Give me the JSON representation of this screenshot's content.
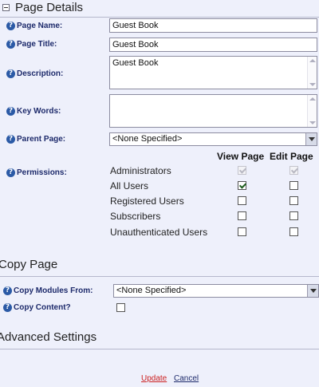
{
  "page_details": {
    "title": "Page Details",
    "fields": {
      "page_name": {
        "label": "Page Name:",
        "value": "Guest Book"
      },
      "page_title": {
        "label": "Page Title:",
        "value": "Guest Book"
      },
      "description": {
        "label": "Description:",
        "value": "Guest Book"
      },
      "key_words": {
        "label": "Key Words:",
        "value": ""
      },
      "parent_page": {
        "label": "Parent Page:",
        "value": "<None Specified>"
      },
      "permissions": {
        "label": "Permissions:"
      }
    },
    "permissions_table": {
      "columns": [
        "View Page",
        "Edit Page"
      ],
      "rows": [
        {
          "role": "Administrators",
          "view": true,
          "edit": true,
          "disabled": true
        },
        {
          "role": "All Users",
          "view": true,
          "edit": false,
          "disabled": false
        },
        {
          "role": "Registered Users",
          "view": false,
          "edit": false,
          "disabled": false
        },
        {
          "role": "Subscribers",
          "view": false,
          "edit": false,
          "disabled": false
        },
        {
          "role": "Unauthenticated Users",
          "view": false,
          "edit": false,
          "disabled": false
        }
      ]
    }
  },
  "copy_page": {
    "title": "Copy Page",
    "copy_modules_from": {
      "label": "Copy Modules From:",
      "value": "<None Specified>"
    },
    "copy_content": {
      "label": "Copy Content?",
      "checked": false
    }
  },
  "advanced_settings": {
    "title": "Advanced Settings"
  },
  "actions": {
    "update_label": "Update",
    "cancel_label": "Cancel",
    "update_color": "#cc2222",
    "cancel_color": "#1d2a6b"
  },
  "colors": {
    "background": "#eef0fb",
    "label": "#1d2a6b",
    "help_icon": "#2b5aa6"
  },
  "icons": {
    "help": "help-icon",
    "collapse": "minus-box-icon"
  }
}
